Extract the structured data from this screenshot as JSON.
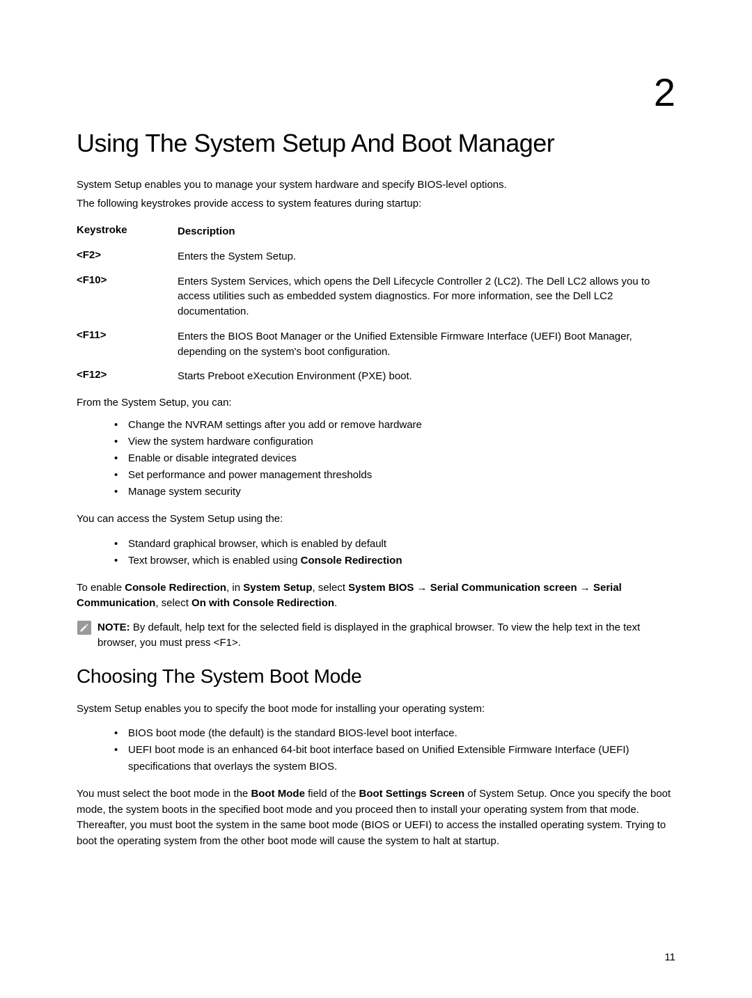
{
  "chapter_number": "2",
  "title": "Using The System Setup And Boot Manager",
  "intro_line1": "System Setup enables you to manage your system hardware and specify BIOS-level options.",
  "intro_line2": "The following keystrokes provide access to system features during startup:",
  "table_header": {
    "col1": "Keystroke",
    "col2": "Description"
  },
  "keystrokes": [
    {
      "key": "<F2>",
      "desc": "Enters the System Setup."
    },
    {
      "key": "<F10>",
      "desc": "Enters System Services, which opens the Dell Lifecycle Controller 2 (LC2). The Dell LC2 allows you to access utilities such as embedded system diagnostics. For more information, see the Dell LC2 documentation."
    },
    {
      "key": "<F11>",
      "desc": "Enters the BIOS Boot Manager or the Unified Extensible Firmware Interface (UEFI) Boot Manager, depending on the system's boot configuration."
    },
    {
      "key": "<F12>",
      "desc": "Starts Preboot eXecution Environment (PXE) boot."
    }
  ],
  "after_table": "From the System Setup, you can:",
  "setup_bullets": [
    "Change the NVRAM settings after you add or remove hardware",
    "View the system hardware configuration",
    "Enable or disable integrated devices",
    "Set performance and power management thresholds",
    "Manage system security"
  ],
  "access_intro": "You can access the System Setup using the:",
  "access_bullets_prefix": [
    "Standard graphical browser, which is enabled by default",
    "Text browser, which is enabled using "
  ],
  "access_bullet2_bold": "Console Redirection",
  "enable_sentence": {
    "p1": "To enable ",
    "b1": "Console Redirection",
    "p2": ", in ",
    "b2": "System Setup",
    "p3": ", select ",
    "b3": "System BIOS",
    "arrow1": " → ",
    "b4": "Serial Communication screen",
    "arrow2": " → ",
    "b5": "Serial Communication",
    "p4": ", select ",
    "b6": "On with Console Redirection",
    "p5": "."
  },
  "note": {
    "label": "NOTE:",
    "text": " By default, help text for the selected field is displayed in the graphical browser. To view the help text in the text browser, you must press <F1>."
  },
  "section_title": "Choosing The System Boot Mode",
  "section_intro": "System Setup enables you to specify the boot mode for installing your operating system:",
  "boot_bullets": [
    "BIOS boot mode (the default) is the standard BIOS-level boot interface.",
    "UEFI boot mode is an enhanced 64-bit boot interface based on Unified Extensible Firmware Interface (UEFI) specifications that overlays the system BIOS."
  ],
  "final_para": {
    "p1": "You must select the boot mode in the ",
    "b1": "Boot Mode",
    "p2": " field of the ",
    "b2": "Boot Settings Screen",
    "p3": " of System Setup. Once you specify the boot mode, the system boots in the specified boot mode and you proceed then to install your operating system from that mode. Thereafter, you must boot the system in the same boot mode (BIOS or UEFI) to access the installed operating system. Trying to boot the operating system from the other boot mode will cause the system to halt at startup."
  },
  "page_number": "11"
}
